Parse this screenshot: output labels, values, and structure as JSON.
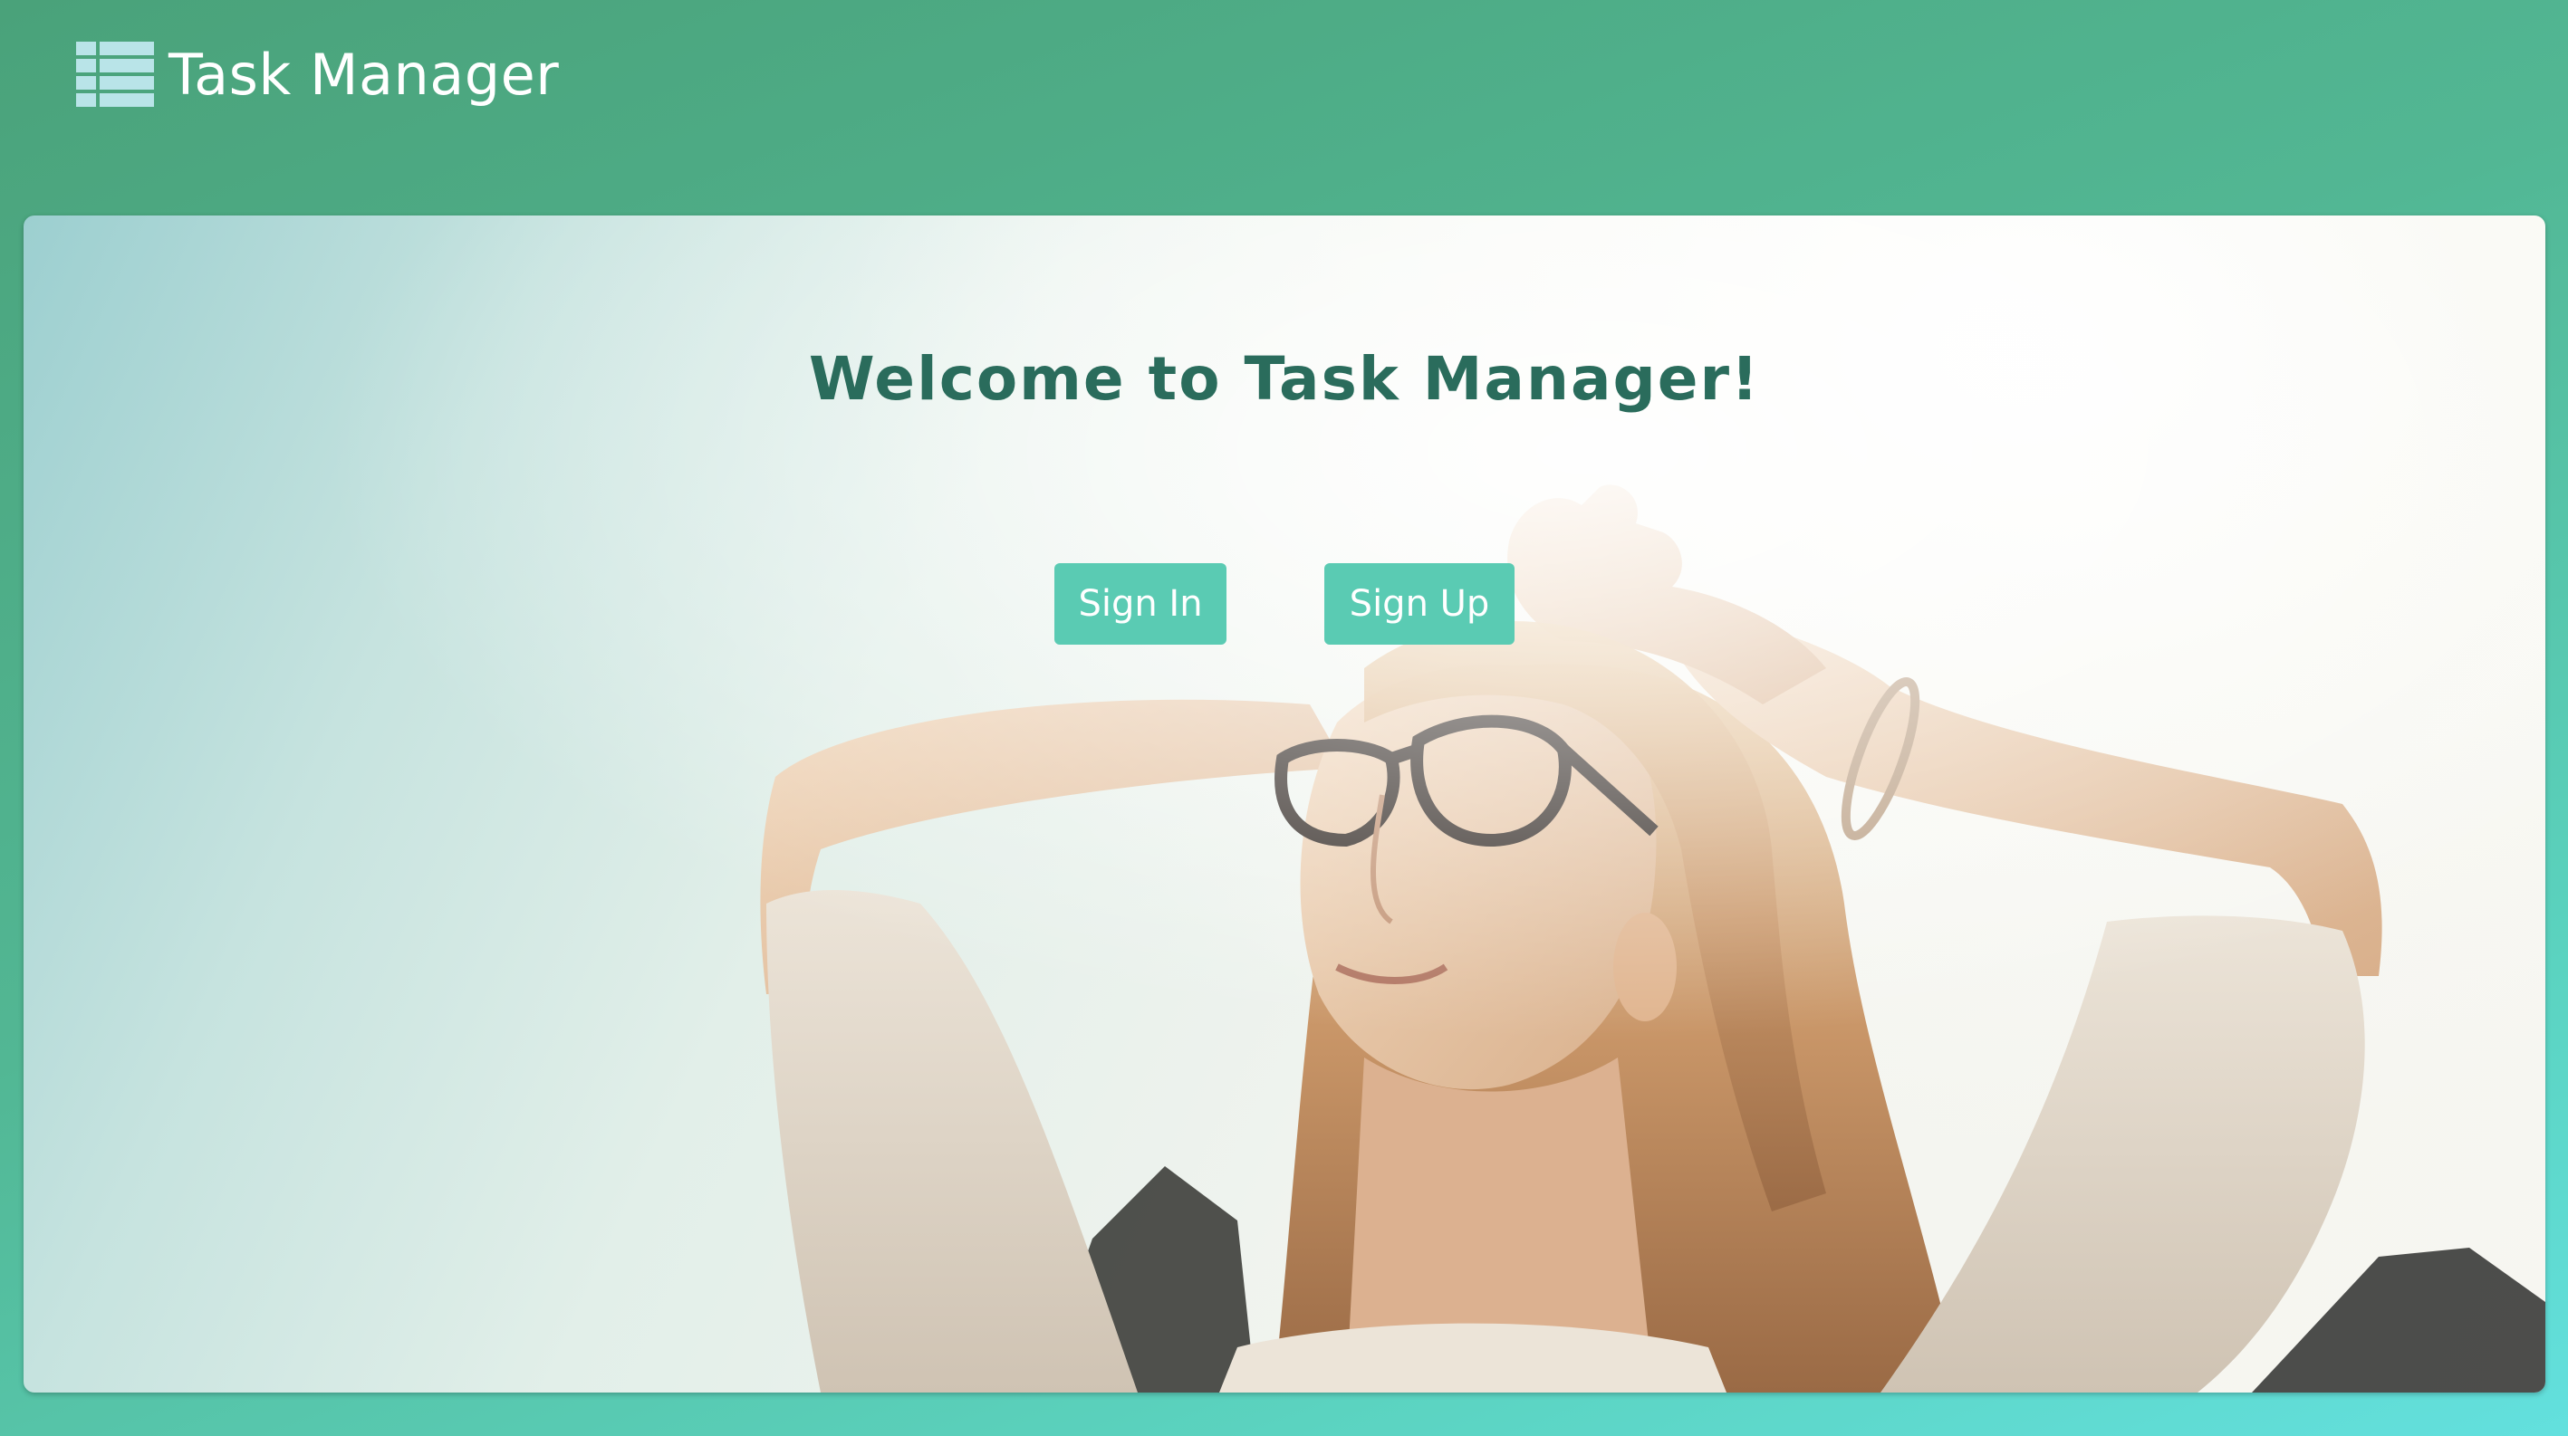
{
  "header": {
    "brand": "Task Manager",
    "logo_icon": "list-table-icon"
  },
  "hero": {
    "title": "Welcome to Task Manager!",
    "image": "woman-relaxing-in-sunlight-photo"
  },
  "actions": {
    "sign_in_label": "Sign In",
    "sign_up_label": "Sign Up"
  },
  "colors": {
    "accent": "#5acbb3",
    "title_text": "#2a6c5c",
    "background_start": "#4aa27a",
    "background_end": "#63e0de",
    "logo_icon": "#b9e4e8"
  }
}
